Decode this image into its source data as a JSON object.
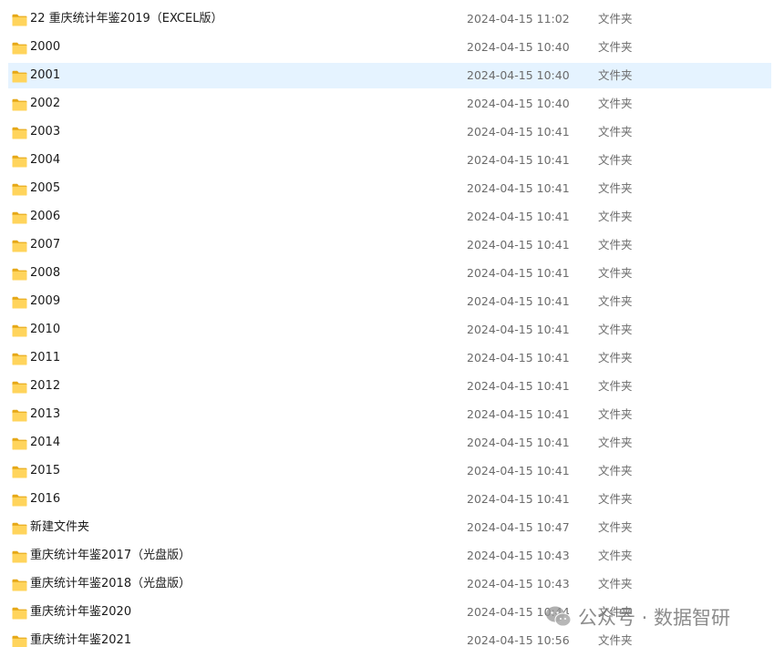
{
  "files": [
    {
      "name": "22 重庆统计年鉴2019（EXCEL版）",
      "date": "2024-04-15 11:02",
      "type": "文件夹"
    },
    {
      "name": "2000",
      "date": "2024-04-15 10:40",
      "type": "文件夹"
    },
    {
      "name": "2001",
      "date": "2024-04-15 10:40",
      "type": "文件夹"
    },
    {
      "name": "2002",
      "date": "2024-04-15 10:40",
      "type": "文件夹"
    },
    {
      "name": "2003",
      "date": "2024-04-15 10:41",
      "type": "文件夹"
    },
    {
      "name": "2004",
      "date": "2024-04-15 10:41",
      "type": "文件夹"
    },
    {
      "name": "2005",
      "date": "2024-04-15 10:41",
      "type": "文件夹"
    },
    {
      "name": "2006",
      "date": "2024-04-15 10:41",
      "type": "文件夹"
    },
    {
      "name": "2007",
      "date": "2024-04-15 10:41",
      "type": "文件夹"
    },
    {
      "name": "2008",
      "date": "2024-04-15 10:41",
      "type": "文件夹"
    },
    {
      "name": "2009",
      "date": "2024-04-15 10:41",
      "type": "文件夹"
    },
    {
      "name": "2010",
      "date": "2024-04-15 10:41",
      "type": "文件夹"
    },
    {
      "name": "2011",
      "date": "2024-04-15 10:41",
      "type": "文件夹"
    },
    {
      "name": "2012",
      "date": "2024-04-15 10:41",
      "type": "文件夹"
    },
    {
      "name": "2013",
      "date": "2024-04-15 10:41",
      "type": "文件夹"
    },
    {
      "name": "2014",
      "date": "2024-04-15 10:41",
      "type": "文件夹"
    },
    {
      "name": "2015",
      "date": "2024-04-15 10:41",
      "type": "文件夹"
    },
    {
      "name": "2016",
      "date": "2024-04-15 10:41",
      "type": "文件夹"
    },
    {
      "name": "新建文件夹",
      "date": "2024-04-15 10:47",
      "type": "文件夹"
    },
    {
      "name": "重庆统计年鉴2017（光盘版）",
      "date": "2024-04-15 10:43",
      "type": "文件夹"
    },
    {
      "name": "重庆统计年鉴2018（光盘版）",
      "date": "2024-04-15 10:43",
      "type": "文件夹"
    },
    {
      "name": "重庆统计年鉴2020",
      "date": "2024-04-15 10:44",
      "type": "文件夹"
    },
    {
      "name": "重庆统计年鉴2021",
      "date": "2024-04-15 10:56",
      "type": "文件夹"
    }
  ],
  "selected_index": 2,
  "icons": {
    "folder": "folder-icon",
    "watermark": "wechat-icon"
  },
  "colors": {
    "selection": "#e5f3ff",
    "folder_front": "#ffd45c",
    "folder_back": "#e6a817",
    "meta_text": "#6b6b6b"
  },
  "watermark": {
    "text": "公众号 · 数据智研"
  }
}
